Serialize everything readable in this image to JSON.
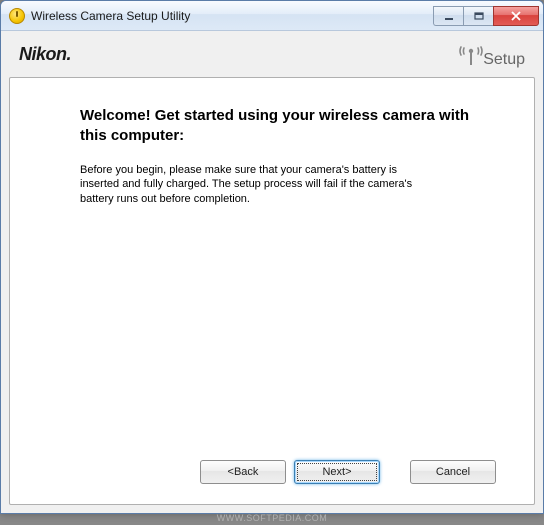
{
  "window": {
    "title": "Wireless Camera Setup Utility"
  },
  "brand": "Nikon.",
  "setup_logo_text": "Setup",
  "content": {
    "heading": "Welcome! Get started using your wireless camera with this computer:",
    "body": "Before you begin, please make sure that your camera's battery is inserted and fully charged. The setup process will fail if the camera's battery runs out before completion."
  },
  "buttons": {
    "back": "<Back",
    "next": "Next>",
    "cancel": "Cancel"
  },
  "watermark": {
    "footer": "WWW.SOFTPEDIA.COM"
  }
}
